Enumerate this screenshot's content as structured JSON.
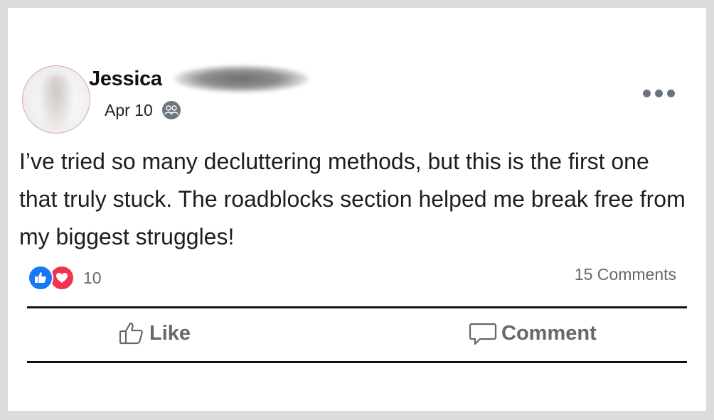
{
  "post": {
    "author_name": "Jessica",
    "date": "Apr 10",
    "text": "I’ve tried so many decluttering methods, but this is the first one that truly stuck. The roadblocks section helped me break free from my biggest struggles!"
  },
  "stats": {
    "reaction_count": "10",
    "comments": "15 Comments"
  },
  "actions": {
    "like_label": "Like",
    "comment_label": "Comment"
  },
  "icons": {
    "audience": "group-audience-icon",
    "more": "more-options-icon",
    "like_reaction": "like-reaction-icon",
    "love_reaction": "love-reaction-icon",
    "like_action": "thumbs-up-icon",
    "comment_action": "comment-bubble-icon"
  },
  "colors": {
    "like_blue": "#1877f2",
    "love_red": "#f0344d",
    "muted_text": "#65676b"
  }
}
